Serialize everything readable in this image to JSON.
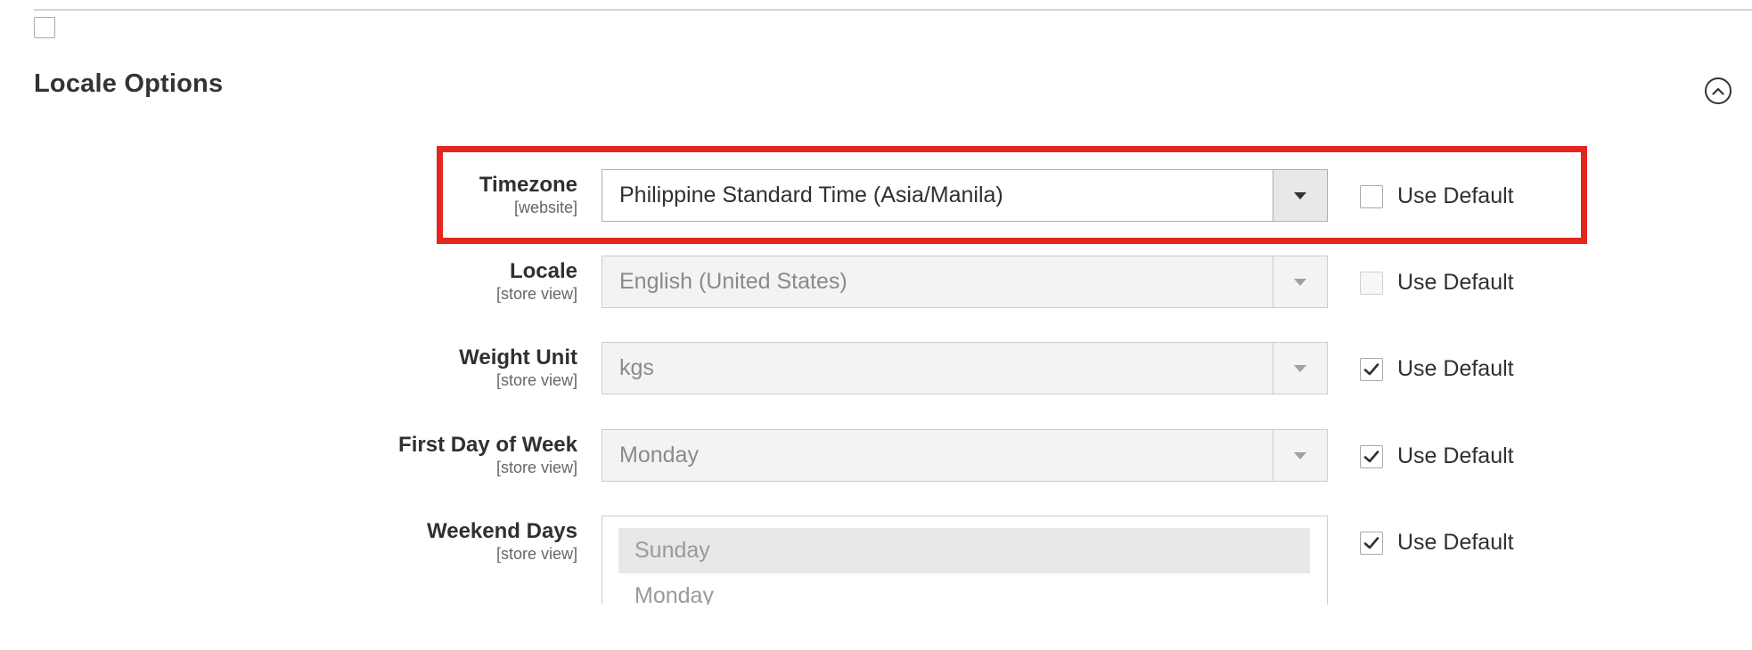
{
  "section": {
    "title": "Locale Options"
  },
  "use_default_label": "Use Default",
  "fields": [
    {
      "label": "Timezone",
      "scope": "[website]",
      "value": "Philippine Standard Time (Asia/Manila)",
      "disabled": false,
      "use_default_checked": false
    },
    {
      "label": "Locale",
      "scope": "[store view]",
      "value": "English (United States)",
      "disabled": true,
      "use_default_checked": false
    },
    {
      "label": "Weight Unit",
      "scope": "[store view]",
      "value": "kgs",
      "disabled": true,
      "use_default_checked": true
    },
    {
      "label": "First Day of Week",
      "scope": "[store view]",
      "value": "Monday",
      "disabled": true,
      "use_default_checked": true
    }
  ],
  "weekend": {
    "label": "Weekend Days",
    "scope": "[store view]",
    "options": [
      "Sunday",
      "Monday"
    ],
    "selected": "Sunday",
    "use_default_checked": true
  },
  "colors": {
    "highlight": "#e3261f"
  }
}
